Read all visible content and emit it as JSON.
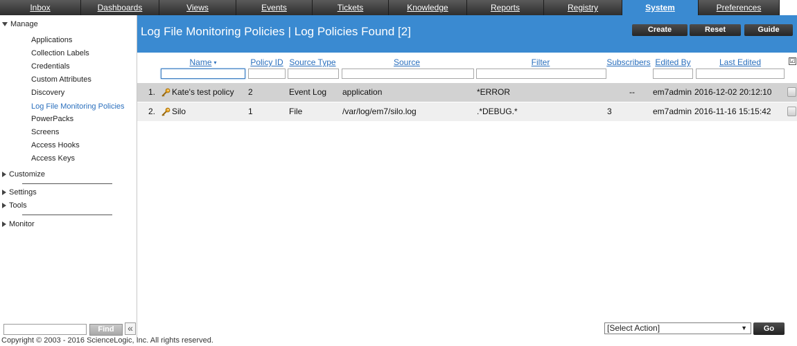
{
  "topnav": {
    "tabs": [
      {
        "label": "Inbox"
      },
      {
        "label": "Dashboards"
      },
      {
        "label": "Views"
      },
      {
        "label": "Events"
      },
      {
        "label": "Tickets"
      },
      {
        "label": "Knowledge"
      },
      {
        "label": "Reports"
      },
      {
        "label": "Registry"
      },
      {
        "label": "System"
      },
      {
        "label": "Preferences"
      }
    ],
    "active_tab": "System",
    "active_color": "#3a8ad1"
  },
  "sidebar": {
    "manage_label": "Manage",
    "manage_items": [
      {
        "label": "Applications"
      },
      {
        "label": "Collection Labels"
      },
      {
        "label": "Credentials"
      },
      {
        "label": "Custom Attributes"
      },
      {
        "label": "Discovery"
      },
      {
        "label": "Log File Monitoring Policies"
      },
      {
        "label": "PowerPacks"
      },
      {
        "label": "Screens"
      },
      {
        "label": "Access Hooks"
      },
      {
        "label": "Access Keys"
      }
    ],
    "active_item": "Log File Monitoring Policies",
    "customize_label": "Customize",
    "settings_label": "Settings",
    "tools_label": "Tools",
    "monitor_label": "Monitor",
    "search_value": "",
    "find_label": "Find",
    "collapse_glyph": "«"
  },
  "header": {
    "title": "Log File Monitoring Policies | Log Policies Found [2]",
    "buttons": {
      "create": "Create",
      "reset": "Reset",
      "guide": "Guide"
    }
  },
  "table": {
    "columns": {
      "name": "Name",
      "policy_id": "Policy ID",
      "source_type": "Source Type",
      "source": "Source",
      "filter": "Filter",
      "subscribers": "Subscribers",
      "edited_by": "Edited By",
      "last_edited": "Last Edited"
    },
    "sort_glyph": "▾",
    "select_all_glyph": "☑",
    "rows": [
      {
        "num": "1.",
        "name": "Kate's test policy",
        "policy_id": "2",
        "source_type": "Event Log",
        "source": "application",
        "filter": "*ERROR",
        "subscribers": "--",
        "edited_by": "em7admin",
        "last_edited": "2016-12-02 20:12:10"
      },
      {
        "num": "2.",
        "name": "Silo",
        "policy_id": "1",
        "source_type": "File",
        "source": "/var/log/em7/silo.log",
        "filter": ".*DEBUG.*",
        "subscribers": "3",
        "edited_by": "em7admin",
        "last_edited": "2016-11-16 15:15:42"
      }
    ]
  },
  "actions": {
    "select_label": "[Select Action]",
    "go_label": "Go"
  },
  "footer": {
    "copyright": "Copyright © 2003 - 2016 ScienceLogic, Inc. All rights reserved."
  }
}
